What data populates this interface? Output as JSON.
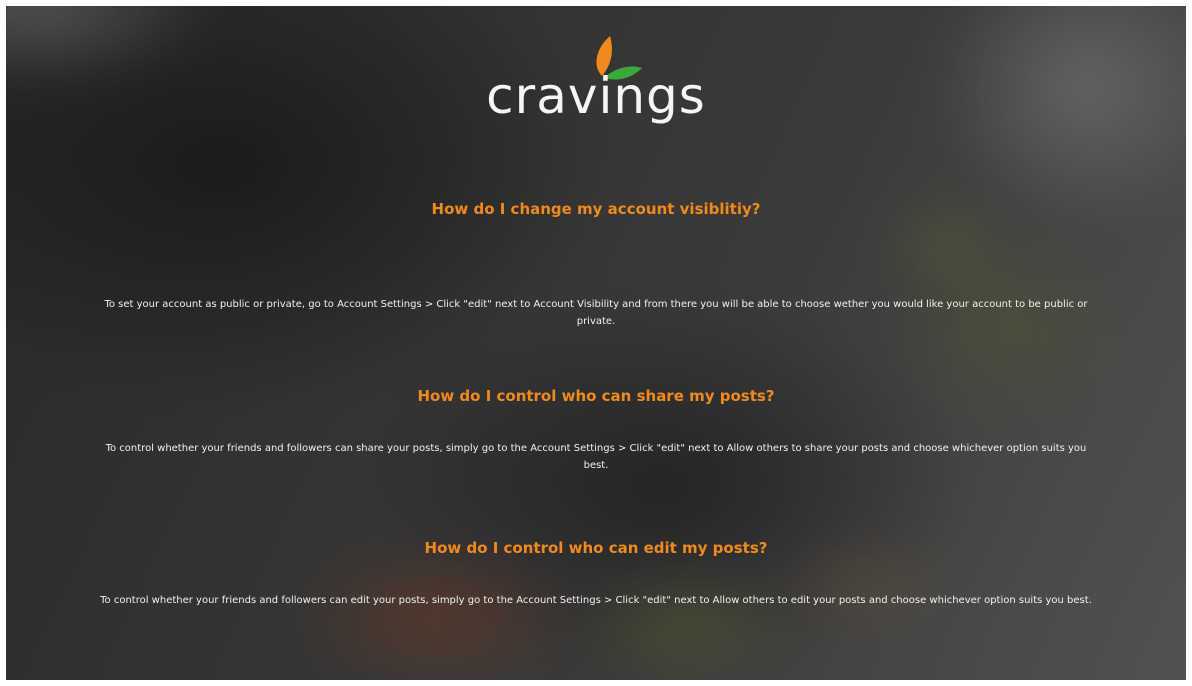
{
  "brand": {
    "name": "cravings",
    "colors": {
      "leaf_orange": "#f08a1e",
      "leaf_green": "#3aa83c",
      "heading": "#f08a1e",
      "text": "#f2f2f0"
    }
  },
  "faq": [
    {
      "question": "How do I change my account visiblitiy?",
      "answer": "To set your account as public or private, go to Account Settings > Click \"edit\" next to Account Visibility and from there you will be able to choose wether you would like your account to be public or private."
    },
    {
      "question": "How do I control who can share my posts?",
      "answer": "To control whether your friends and followers can share your posts, simply go to the Account Settings > Click \"edit\" next to Allow others to share your posts and choose whichever option suits you best."
    },
    {
      "question": "How do I control who can edit my posts?",
      "answer": "To control whether your friends and followers can edit your posts, simply go to the Account Settings > Click \"edit\" next to Allow others to edit your posts and choose whichever option suits you best."
    }
  ]
}
